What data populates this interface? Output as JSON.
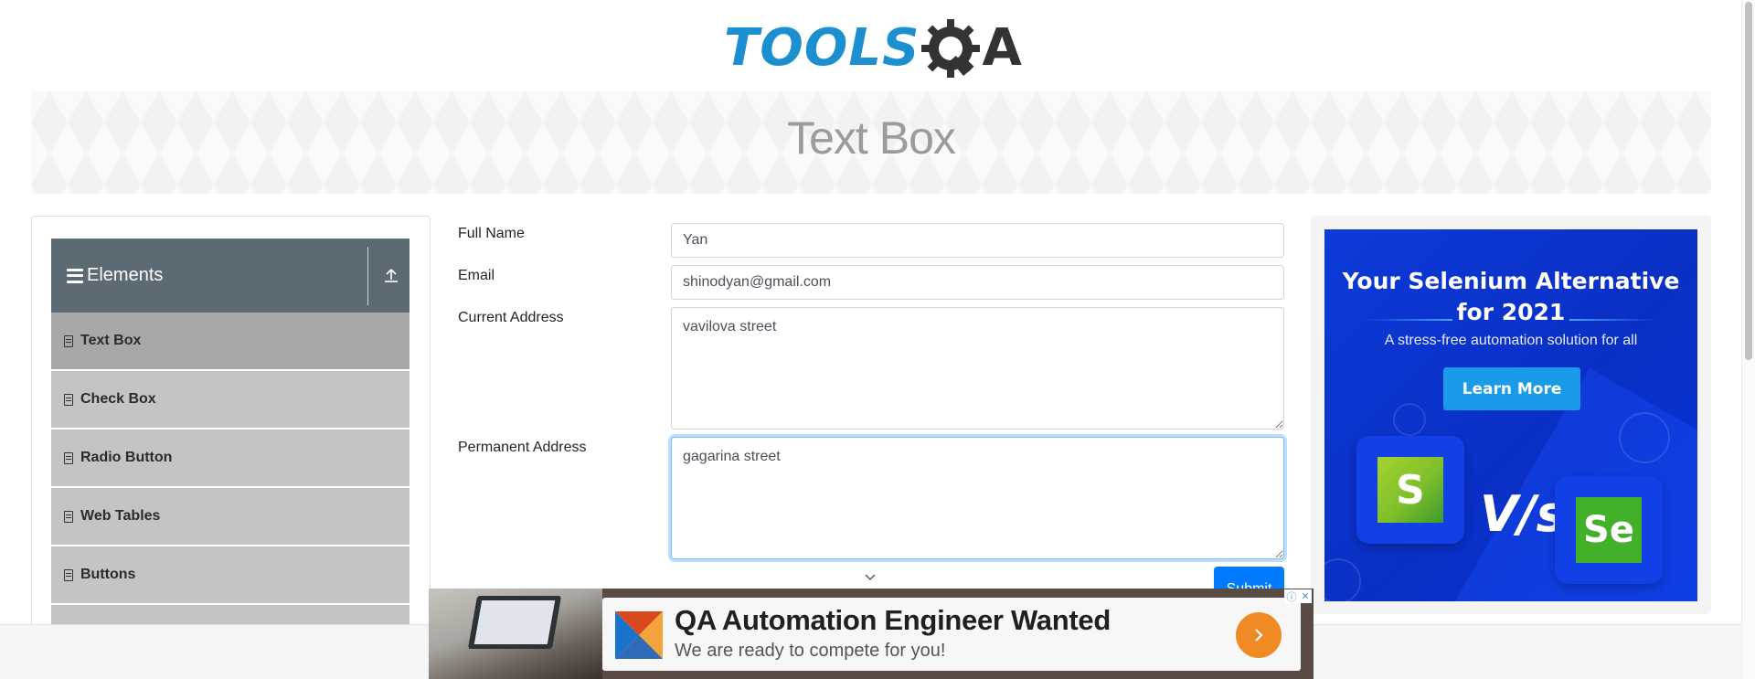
{
  "header": {
    "logo_text_primary": "TOOLS",
    "logo_text_secondary": "A",
    "logo_icon": "gear-q-icon"
  },
  "banner": {
    "title": "Text Box"
  },
  "sidebar": {
    "group_title": "Elements",
    "group_icon": "hamburger-icon",
    "collapse_icon": "upload-arrow-icon",
    "items": [
      {
        "label": "Text Box",
        "active": true
      },
      {
        "label": "Check Box",
        "active": false
      },
      {
        "label": "Radio Button",
        "active": false
      },
      {
        "label": "Web Tables",
        "active": false
      },
      {
        "label": "Buttons",
        "active": false
      }
    ],
    "item_icon": "document-icon"
  },
  "form": {
    "full_name_label": "Full Name",
    "full_name_value": "Yan",
    "email_label": "Email",
    "email_value": "shinodyan@gmail.com",
    "current_address_label": "Current Address",
    "current_address_value": "vavilova street",
    "permanent_address_label": "Permanent Address",
    "permanent_address_value": "gagarina street",
    "submit_label": "Submit"
  },
  "right_ad": {
    "headline": "Your Selenium Alternative for 2021",
    "subline": "A stress-free automation solution for all",
    "button_label": "Learn More",
    "vs_text": "V/s",
    "left_logo_letter": "S",
    "right_logo_letter": "Se"
  },
  "bottom_ad": {
    "title": "QA Automation Engineer Wanted",
    "subtitle": "We are ready to compete for you!",
    "arrow_icon": "chevron-right-icon",
    "choices_icon": "ad-choices-icon"
  },
  "colors": {
    "brand_blue": "#1b8fd0",
    "sidebar_header": "#5c6b73",
    "submit_blue": "#007bff",
    "ad_orange": "#f08a24"
  }
}
